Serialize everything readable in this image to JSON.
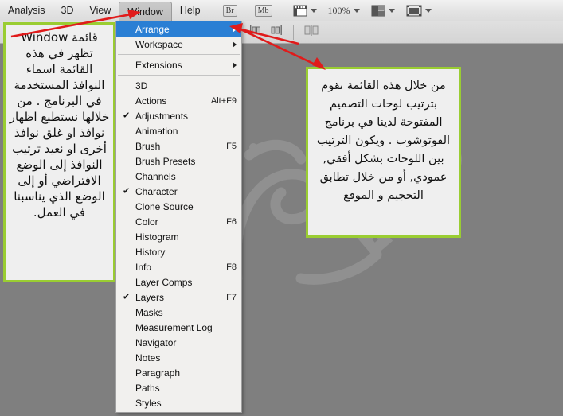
{
  "app": {
    "zoom_level": "100%"
  },
  "menubar": {
    "items": [
      {
        "label": "Analysis",
        "active": false
      },
      {
        "label": "3D",
        "active": false
      },
      {
        "label": "View",
        "active": false
      },
      {
        "label": "Window",
        "active": true
      },
      {
        "label": "Help",
        "active": false
      }
    ],
    "bridge_button": "Br",
    "minibridge_button": "Mb",
    "zoom_value": "100%",
    "icons": [
      "screen-mode-icon",
      "chevron-down-icon",
      "arrange-documents-icon",
      "chevron-down-icon",
      "screen-mode-toggle-icon",
      "chevron-down-icon"
    ]
  },
  "options_bar": {
    "icons": [
      "align-left-edges-icon",
      "align-horizontal-centers-icon",
      "distribute-icon"
    ]
  },
  "window_menu": {
    "items": [
      {
        "label": "Arrange",
        "shortcut": "",
        "checked": false,
        "submenu": true,
        "selected": true,
        "separator_after": false
      },
      {
        "label": "Workspace",
        "shortcut": "",
        "checked": false,
        "submenu": true,
        "selected": false,
        "separator_after": true
      },
      {
        "label": "Extensions",
        "shortcut": "",
        "checked": false,
        "submenu": true,
        "selected": false,
        "separator_after": true
      },
      {
        "label": "3D",
        "shortcut": "",
        "checked": false,
        "submenu": false,
        "selected": false,
        "separator_after": false
      },
      {
        "label": "Actions",
        "shortcut": "Alt+F9",
        "checked": false,
        "submenu": false,
        "selected": false,
        "separator_after": false
      },
      {
        "label": "Adjustments",
        "shortcut": "",
        "checked": true,
        "submenu": false,
        "selected": false,
        "separator_after": false
      },
      {
        "label": "Animation",
        "shortcut": "",
        "checked": false,
        "submenu": false,
        "selected": false,
        "separator_after": false
      },
      {
        "label": "Brush",
        "shortcut": "F5",
        "checked": false,
        "submenu": false,
        "selected": false,
        "separator_after": false
      },
      {
        "label": "Brush Presets",
        "shortcut": "",
        "checked": false,
        "submenu": false,
        "selected": false,
        "separator_after": false
      },
      {
        "label": "Channels",
        "shortcut": "",
        "checked": false,
        "submenu": false,
        "selected": false,
        "separator_after": false
      },
      {
        "label": "Character",
        "shortcut": "",
        "checked": true,
        "submenu": false,
        "selected": false,
        "separator_after": false
      },
      {
        "label": "Clone Source",
        "shortcut": "",
        "checked": false,
        "submenu": false,
        "selected": false,
        "separator_after": false
      },
      {
        "label": "Color",
        "shortcut": "F6",
        "checked": false,
        "submenu": false,
        "selected": false,
        "separator_after": false
      },
      {
        "label": "Histogram",
        "shortcut": "",
        "checked": false,
        "submenu": false,
        "selected": false,
        "separator_after": false
      },
      {
        "label": "History",
        "shortcut": "",
        "checked": false,
        "submenu": false,
        "selected": false,
        "separator_after": false
      },
      {
        "label": "Info",
        "shortcut": "F8",
        "checked": false,
        "submenu": false,
        "selected": false,
        "separator_after": false
      },
      {
        "label": "Layer Comps",
        "shortcut": "",
        "checked": false,
        "submenu": false,
        "selected": false,
        "separator_after": false
      },
      {
        "label": "Layers",
        "shortcut": "F7",
        "checked": true,
        "submenu": false,
        "selected": false,
        "separator_after": false
      },
      {
        "label": "Masks",
        "shortcut": "",
        "checked": false,
        "submenu": false,
        "selected": false,
        "separator_after": false
      },
      {
        "label": "Measurement Log",
        "shortcut": "",
        "checked": false,
        "submenu": false,
        "selected": false,
        "separator_after": false
      },
      {
        "label": "Navigator",
        "shortcut": "",
        "checked": false,
        "submenu": false,
        "selected": false,
        "separator_after": false
      },
      {
        "label": "Notes",
        "shortcut": "",
        "checked": false,
        "submenu": false,
        "selected": false,
        "separator_after": false
      },
      {
        "label": "Paragraph",
        "shortcut": "",
        "checked": false,
        "submenu": false,
        "selected": false,
        "separator_after": false
      },
      {
        "label": "Paths",
        "shortcut": "",
        "checked": false,
        "submenu": false,
        "selected": false,
        "separator_after": false
      },
      {
        "label": "Styles",
        "shortcut": "",
        "checked": false,
        "submenu": false,
        "selected": false,
        "separator_after": false
      }
    ]
  },
  "annotations": {
    "left_note": "قائمة Window تظهر في هذه القائمة اسماء النوافذ المستخدمة في البرنامج . من خلالها نستطيع اظهار نوافذ  او غلق نوافذ أخرى او نعيد ترتيب النوافذ إلى الوضع الافتراضي أو إلى الوضع الذي يناسبنا في العمل.",
    "right_note": "من خلال هذه القائمة نقوم بترتيب لوحات التصميم المفتوحة لدينا في برنامج الفوتوشوب . ويكون الترتيب بين اللوحات بشكل أفقي, عمودي, أو من خلال تطابق التحجيم و الموقع"
  },
  "colors": {
    "callout_border": "#9acd32",
    "callout_fill": "#efefef",
    "arrow": "#e01b1b",
    "menu_highlight": "#2a7fd4",
    "canvas": "#7f7f7f"
  }
}
